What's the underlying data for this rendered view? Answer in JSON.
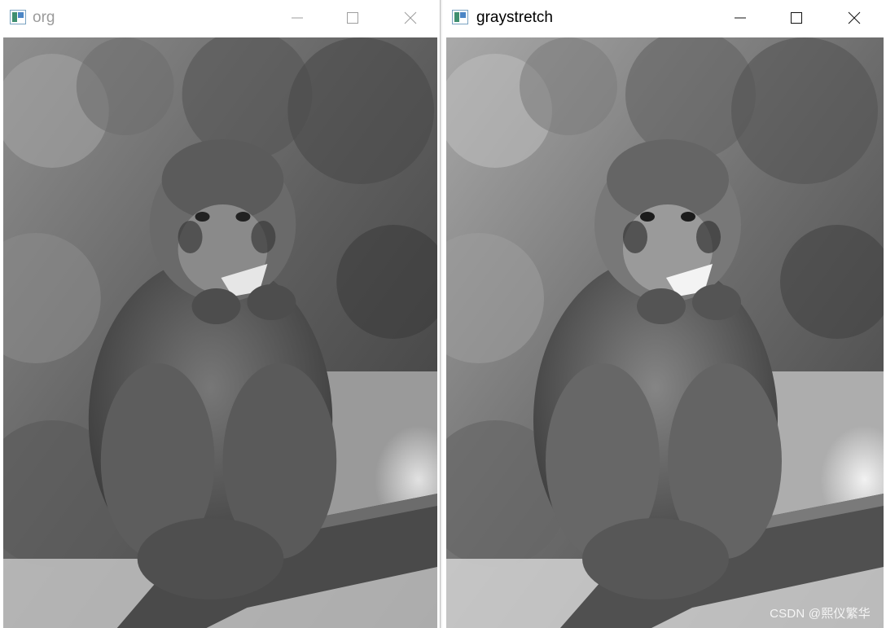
{
  "windows": {
    "org": {
      "title": "org",
      "image_alt": "grayscale photo of a macaque monkey sitting on a wooden rail eating, forest background"
    },
    "graystretch": {
      "title": "graystretch",
      "image_alt": "gray-stretched version of the same macaque monkey photo"
    }
  },
  "controls": {
    "minimize": "minimize-icon",
    "maximize": "maximize-icon",
    "close": "close-icon"
  },
  "watermark": "CSDN @熙仪繁华"
}
